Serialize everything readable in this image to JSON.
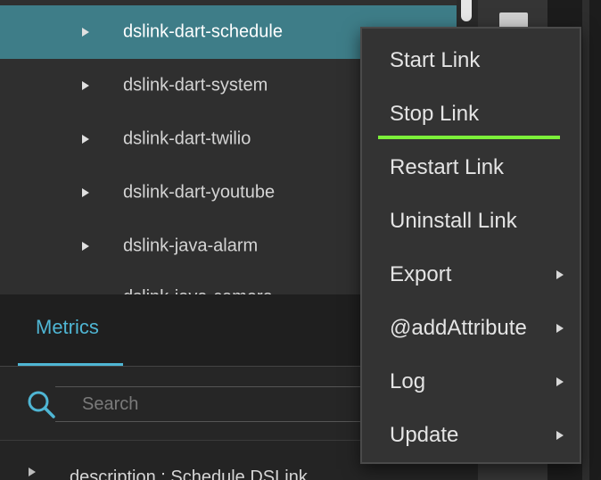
{
  "tree": {
    "items": [
      {
        "label": "dslink-dart-schedule",
        "selected": true
      },
      {
        "label": "dslink-dart-system"
      },
      {
        "label": "dslink-dart-twilio"
      },
      {
        "label": "dslink-dart-youtube"
      },
      {
        "label": "dslink-java-alarm"
      },
      {
        "label": "dslink-java-camera"
      }
    ]
  },
  "metrics": {
    "tab_label": "Metrics",
    "search_placeholder": "Search",
    "row_label": "description : Schedule DSLink"
  },
  "context_menu": {
    "items": [
      {
        "label": "Start Link"
      },
      {
        "label": "Stop Link",
        "highlighted": true
      },
      {
        "label": "Restart Link"
      },
      {
        "label": "Uninstall Link"
      },
      {
        "label": "Export",
        "submenu": true
      },
      {
        "label": "@addAttribute",
        "submenu": true
      },
      {
        "label": "Log",
        "submenu": true
      },
      {
        "label": "Update",
        "submenu": true
      }
    ]
  },
  "colors": {
    "selected_row": "#3e7d88",
    "accent": "#4fb6d4",
    "highlight_bar": "#7cf03a",
    "menu_bg": "#333333"
  },
  "icons": {
    "search": "search-icon",
    "expand": "caret-right-icon",
    "submenu": "chevron-right-icon"
  }
}
